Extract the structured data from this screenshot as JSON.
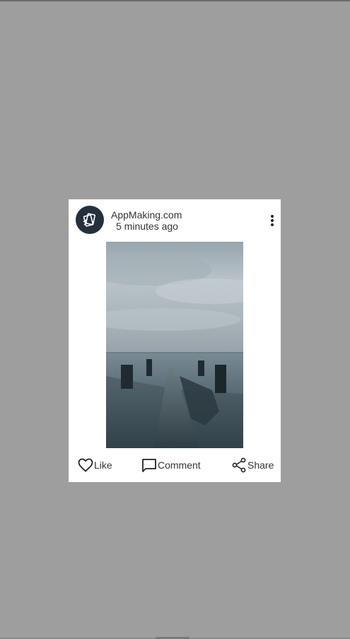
{
  "post": {
    "author": "AppMaking.com",
    "time": "5 minutes ago",
    "avatar_icon": "app-logo-icon",
    "image_description_icon": "pier-photo"
  },
  "actions": {
    "like_label": "Like",
    "comment_label": "Comment",
    "share_label": "Share"
  },
  "colors": {
    "backdrop": "#9e9e9e",
    "card": "#ffffff",
    "avatar": "#23303d",
    "text": "#333333"
  }
}
